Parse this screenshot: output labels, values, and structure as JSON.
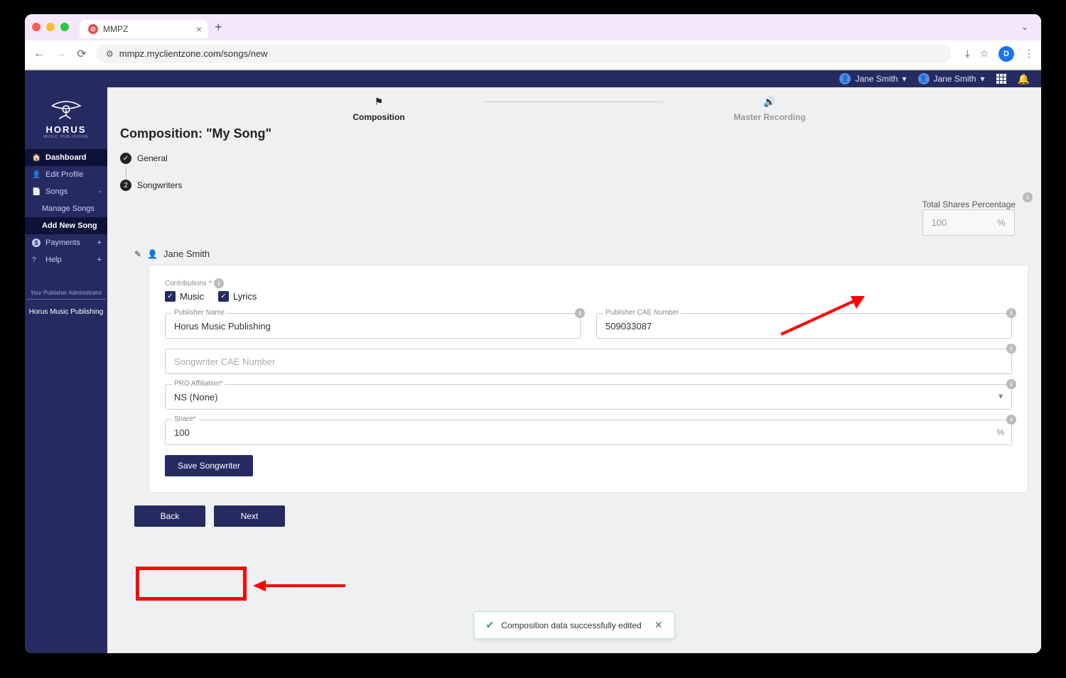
{
  "browser": {
    "tab_title": "MMPZ",
    "url": "mmpz.myclientzone.com/songs/new"
  },
  "topbar": {
    "user1": "Jane Smith",
    "user2": "Jane Smith"
  },
  "sidebar": {
    "brand": "HORUS",
    "brand_sub": "MUSIC PUBLISHING",
    "items": [
      {
        "label": "Dashboard",
        "icon": "🏠"
      },
      {
        "label": "Edit Profile",
        "icon": "👤"
      },
      {
        "label": "Songs",
        "icon": "📄",
        "exp": "-"
      },
      {
        "label": "Manage Songs",
        "sub": true
      },
      {
        "label": "Add New Song",
        "sub": true,
        "active": true
      },
      {
        "label": "Payments",
        "icon": "$",
        "exp": "+"
      },
      {
        "label": "Help",
        "icon": "?",
        "exp": "+"
      }
    ],
    "admin_label": "Your Publisher Administrator",
    "publisher": "Horus Music Publishing"
  },
  "wizard": {
    "step1": "Composition",
    "step2": "Master Recording"
  },
  "page": {
    "title": "Composition: \"My Song\"",
    "step_general": "General",
    "step_songwriters": "Songwriters"
  },
  "shares": {
    "label": "Total Shares Percentage",
    "value": "100",
    "unit": "%"
  },
  "songwriter": {
    "name": "Jane Smith"
  },
  "form": {
    "contributions_label": "Contributions",
    "music": "Music",
    "lyrics": "Lyrics",
    "pub_name_label": "Publisher Name",
    "pub_name": "Horus Music Publishing",
    "pub_cae_label": "Publisher CAE Number",
    "pub_cae": "509033087",
    "sw_cae_label": "Songwriter CAE Number",
    "sw_cae": "",
    "sw_cae_ph": "Songwriter CAE Number",
    "pro_label": "PRO Affiliation",
    "pro_value": "NS (None)",
    "share_label": "Share",
    "share_value": "100",
    "share_unit": "%",
    "save_btn": "Save Songwriter"
  },
  "nav_buttons": {
    "back": "Back",
    "next": "Next"
  },
  "toast": {
    "message": "Composition data successfully edited"
  }
}
